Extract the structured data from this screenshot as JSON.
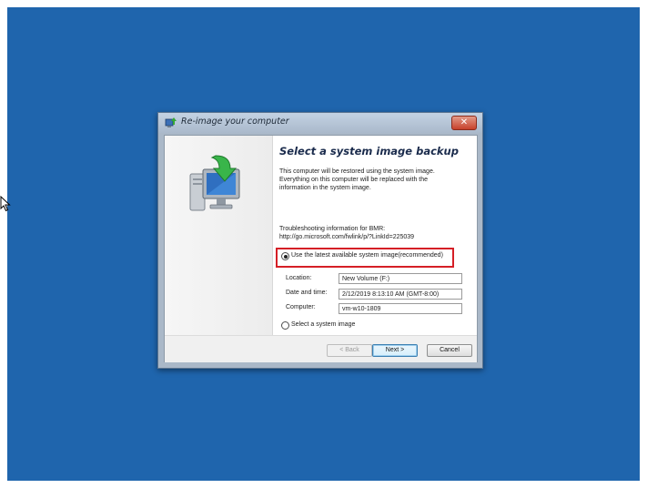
{
  "dialog": {
    "title": "Re-image your computer",
    "close_glyph": "✕",
    "heading": "Select a system image backup",
    "description_lines": [
      "This computer will be restored using the system image.",
      "Everything on this computer will be replaced with the",
      "information in the system image."
    ],
    "troubleshooting_lines": [
      "Troubleshooting information for BMR:",
      "http://go.microsoft.com/fwlink/p/?LinkId=225039"
    ],
    "option_latest": {
      "label": "Use the latest available system image(recommended)",
      "selected": true
    },
    "image_info": {
      "location_label": "Location:",
      "location_value": "New Volume (F:)",
      "datetime_label": "Date and time:",
      "datetime_value": "2/12/2019 8:13:10 AM (GMT-8:00)",
      "computer_label": "Computer:",
      "computer_value": "vm-w10-1809"
    },
    "option_select": {
      "label": "Select a system image",
      "selected": false
    },
    "buttons": {
      "back": "< Back",
      "next": "Next >",
      "cancel": "Cancel"
    }
  },
  "colors": {
    "desktop_background": "#1f65ad",
    "highlight_box": "#d51f26",
    "close_button": "#c7412b"
  },
  "icons": [
    "backup-restore-icon",
    "computer-restore-illustration",
    "mouse-cursor-icon",
    "close-icon"
  ]
}
